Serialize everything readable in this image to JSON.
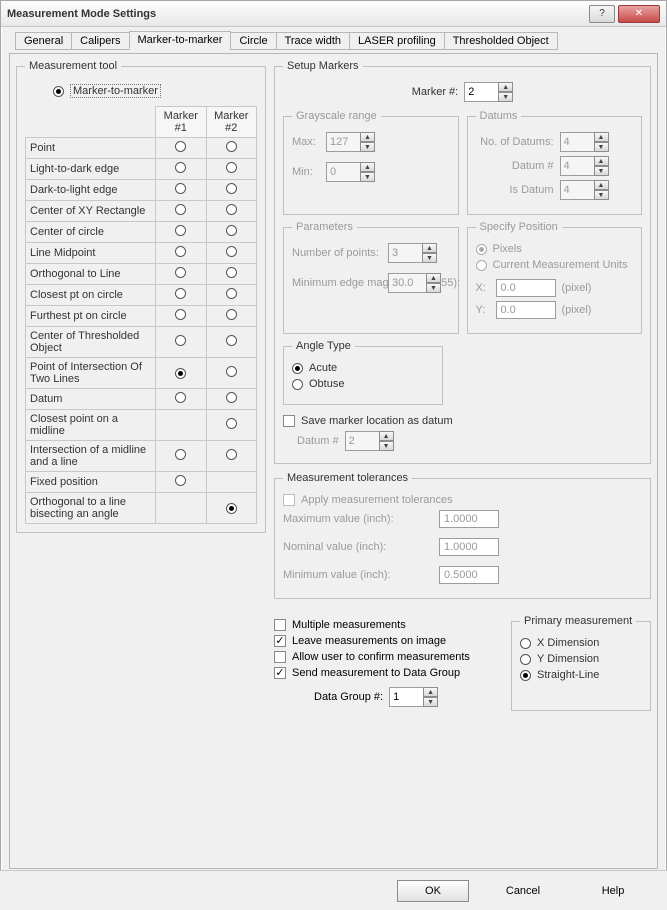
{
  "title": "Measurement Mode Settings",
  "tabs": [
    "General",
    "Calipers",
    "Marker-to-marker",
    "Circle",
    "Trace width",
    "LASER profiling",
    "Thresholded Object"
  ],
  "active_tab_index": 2,
  "measurement_tool": {
    "legend": "Measurement tool",
    "mode_label": "Marker-to-marker",
    "col_headers": [
      "Marker #1",
      "Marker #2"
    ],
    "rows": [
      {
        "label": "Point",
        "m1": "off",
        "m2": "off"
      },
      {
        "label": "Light-to-dark edge",
        "m1": "off",
        "m2": "off"
      },
      {
        "label": "Dark-to-light edge",
        "m1": "off",
        "m2": "off"
      },
      {
        "label": "Center of XY Rectangle",
        "m1": "off",
        "m2": "off"
      },
      {
        "label": "Center of circle",
        "m1": "off",
        "m2": "off"
      },
      {
        "label": "Line Midpoint",
        "m1": "off",
        "m2": "off"
      },
      {
        "label": "Orthogonal to Line",
        "m1": "off",
        "m2": "off"
      },
      {
        "label": "Closest pt on circle",
        "m1": "off",
        "m2": "off"
      },
      {
        "label": "Furthest pt on circle",
        "m1": "off",
        "m2": "off"
      },
      {
        "label": "Center of Thresholded Object",
        "m1": "off",
        "m2": "off"
      },
      {
        "label": "Point of Intersection Of Two Lines",
        "m1": "on",
        "m2": "off"
      },
      {
        "label": "Datum",
        "m1": "off",
        "m2": "off"
      },
      {
        "label": "Closest point on a midline",
        "m1": null,
        "m2": "off"
      },
      {
        "label": "Intersection of a midline and a line",
        "m1": "off",
        "m2": "off"
      },
      {
        "label": "Fixed position",
        "m1": "off",
        "m2": null
      },
      {
        "label": "Orthogonal to a line bisecting an angle",
        "m1": null,
        "m2": "on"
      }
    ]
  },
  "setup_markers": {
    "legend": "Setup Markers",
    "marker_num_label": "Marker #:",
    "marker_num_value": "2",
    "grayscale": {
      "legend": "Grayscale range",
      "max_label": "Max:",
      "max_value": "127",
      "min_label": "Min:",
      "min_value": "0"
    },
    "datums": {
      "legend": "Datums",
      "no_label": "No. of Datums:",
      "no_value": "4",
      "dnum_label": "Datum #",
      "dnum_value": "4",
      "isd_label": "Is Datum",
      "isd_value": "4"
    },
    "parameters": {
      "legend": "Parameters",
      "npoints_label": "Number of points:",
      "npoints_value": "3",
      "edge_label": "Minimum edge magnitude (0-255):",
      "edge_value": "30.0"
    },
    "specify_pos": {
      "legend": "Specify Position",
      "pixels_label": "Pixels",
      "units_label": "Current Measurement Units",
      "selected": "pixels",
      "x_label": "X:",
      "x_value": "0.0",
      "x_unit": "(pixel)",
      "y_label": "Y:",
      "y_value": "0.0",
      "y_unit": "(pixel)"
    },
    "angle_type": {
      "legend": "Angle Type",
      "acute": "Acute",
      "obtuse": "Obtuse",
      "selected": "acute"
    },
    "save_datum": {
      "check_label": "Save marker location as datum",
      "datum_num_label": "Datum #",
      "datum_num_value": "2"
    }
  },
  "tolerances": {
    "legend": "Measurement tolerances",
    "apply_label": "Apply measurement tolerances",
    "max_label": "Maximum value (inch):",
    "max_value": "1.0000",
    "nom_label": "Nominal value (inch):",
    "nom_value": "1.0000",
    "min_label": "Minimum value (inch):",
    "min_value": "0.5000"
  },
  "options": {
    "multi_label": "Multiple measurements",
    "leave_label": "Leave measurements on image",
    "confirm_label": "Allow user to confirm measurements",
    "send_label": "Send measurement to Data Group",
    "dg_label": "Data Group #:",
    "dg_value": "1"
  },
  "primary": {
    "legend": "Primary measurement",
    "x": "X Dimension",
    "y": "Y Dimension",
    "sl": "Straight-Line",
    "selected": "sl"
  },
  "buttons": {
    "ok": "OK",
    "cancel": "Cancel",
    "help": "Help"
  }
}
